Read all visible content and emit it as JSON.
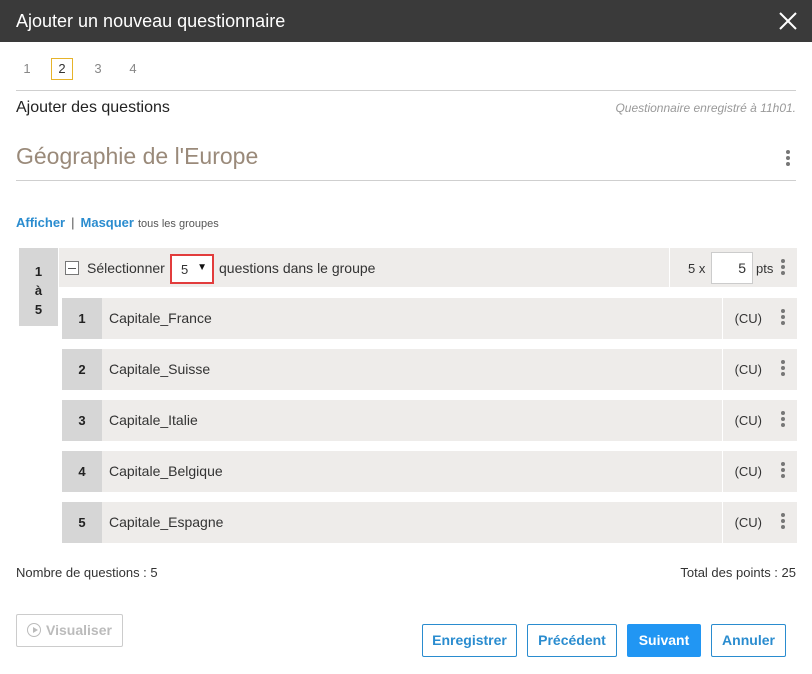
{
  "window": {
    "title": "Ajouter un nouveau questionnaire",
    "close_icon": "close-icon"
  },
  "steps": [
    "1",
    "2",
    "3",
    "4"
  ],
  "active_step": "2",
  "section": {
    "title": "Ajouter des questions",
    "saved_text": "Questionnaire enregistré à 11h01."
  },
  "questionnaire": {
    "title": "Géographie de l'Europe"
  },
  "groups_toggle": {
    "show": "Afficher",
    "separator": "|",
    "hide": "Masquer",
    "suffix": "tous les groupes"
  },
  "group": {
    "range_from": "1",
    "range_sep": "à",
    "range_to": "5",
    "select_label": "Sélectionner",
    "select_value": "5",
    "in_group_label": "questions dans le groupe",
    "multiplier": "5 x",
    "points_value": "5",
    "points_unit": "pts"
  },
  "questions": [
    {
      "num": "1",
      "name": "Capitale_France",
      "type": "(CU)"
    },
    {
      "num": "2",
      "name": "Capitale_Suisse",
      "type": "(CU)"
    },
    {
      "num": "3",
      "name": "Capitale_Italie",
      "type": "(CU)"
    },
    {
      "num": "4",
      "name": "Capitale_Belgique",
      "type": "(CU)"
    },
    {
      "num": "5",
      "name": "Capitale_Espagne",
      "type": "(CU)"
    }
  ],
  "summary": {
    "count_label": "Nombre de questions : 5",
    "total_label": "Total des points : 25"
  },
  "buttons": {
    "preview": "Visualiser",
    "save": "Enregistrer",
    "previous": "Précédent",
    "next": "Suivant",
    "cancel": "Annuler"
  },
  "colors": {
    "accent": "#2196f3",
    "link": "#2a8ccf",
    "highlight": "#e23c3c",
    "active_step": "#e6b32a"
  }
}
